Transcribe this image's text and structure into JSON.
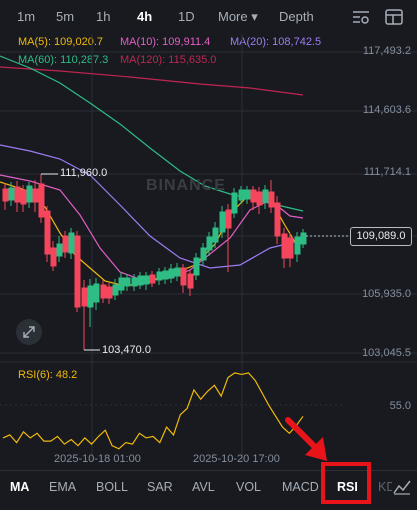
{
  "timeframes": {
    "items": [
      "1m",
      "5m",
      "1h",
      "4h",
      "1D",
      "More ▾",
      "Depth"
    ],
    "active": "4h"
  },
  "ma_legend": {
    "ma5": "MA(5): 109,020.7",
    "ma10": "MA(10): 109,911.4",
    "ma20": "MA(20): 108,742.5",
    "ma60": "MA(60): 110,287.3",
    "ma120": "MA(120): 115,635.0"
  },
  "colors": {
    "background": "#181a20",
    "up": "#2ebd85",
    "down": "#f6465d",
    "ma5": "#f0b90b",
    "ma10": "#e25fc5",
    "ma20": "#9c7df0",
    "ma60": "#2ebd85",
    "ma120": "#c0254f",
    "highlight": "#e8141a"
  },
  "price_axis": [
    "117,493.2",
    "114,603.6",
    "111,714.1",
    "105,935.0",
    "103,045.5"
  ],
  "last_price": "109,089.0",
  "annotations": {
    "high": "111,960.0",
    "low": "103,470.0"
  },
  "watermark": "BINANCE",
  "rsi": {
    "label": "RSI(6): 48.2",
    "level": "55.0",
    "values": [
      31,
      33,
      28,
      35,
      31,
      34,
      29,
      29,
      32,
      27,
      30,
      26,
      31,
      27,
      32,
      36,
      26,
      24,
      28,
      27,
      34,
      31,
      32,
      28,
      38,
      33,
      46,
      50,
      62,
      56,
      61,
      65,
      58,
      70,
      73,
      72,
      73,
      68,
      60,
      52,
      45,
      38,
      34,
      39,
      45
    ]
  },
  "time_axis": [
    "2025-10-18 01:00",
    "2025-10-20 17:00"
  ],
  "indicators": {
    "items": [
      "MA",
      "EMA",
      "BOLL",
      "SAR",
      "AVL",
      "VOL",
      "MACD",
      "RSI",
      "KD"
    ],
    "active_main": "MA",
    "active_sub": "RSI"
  },
  "icons": {
    "settings": "chart-settings-icon",
    "fullscreen": "expand-icon",
    "drawing": "line-draw-icon"
  }
}
